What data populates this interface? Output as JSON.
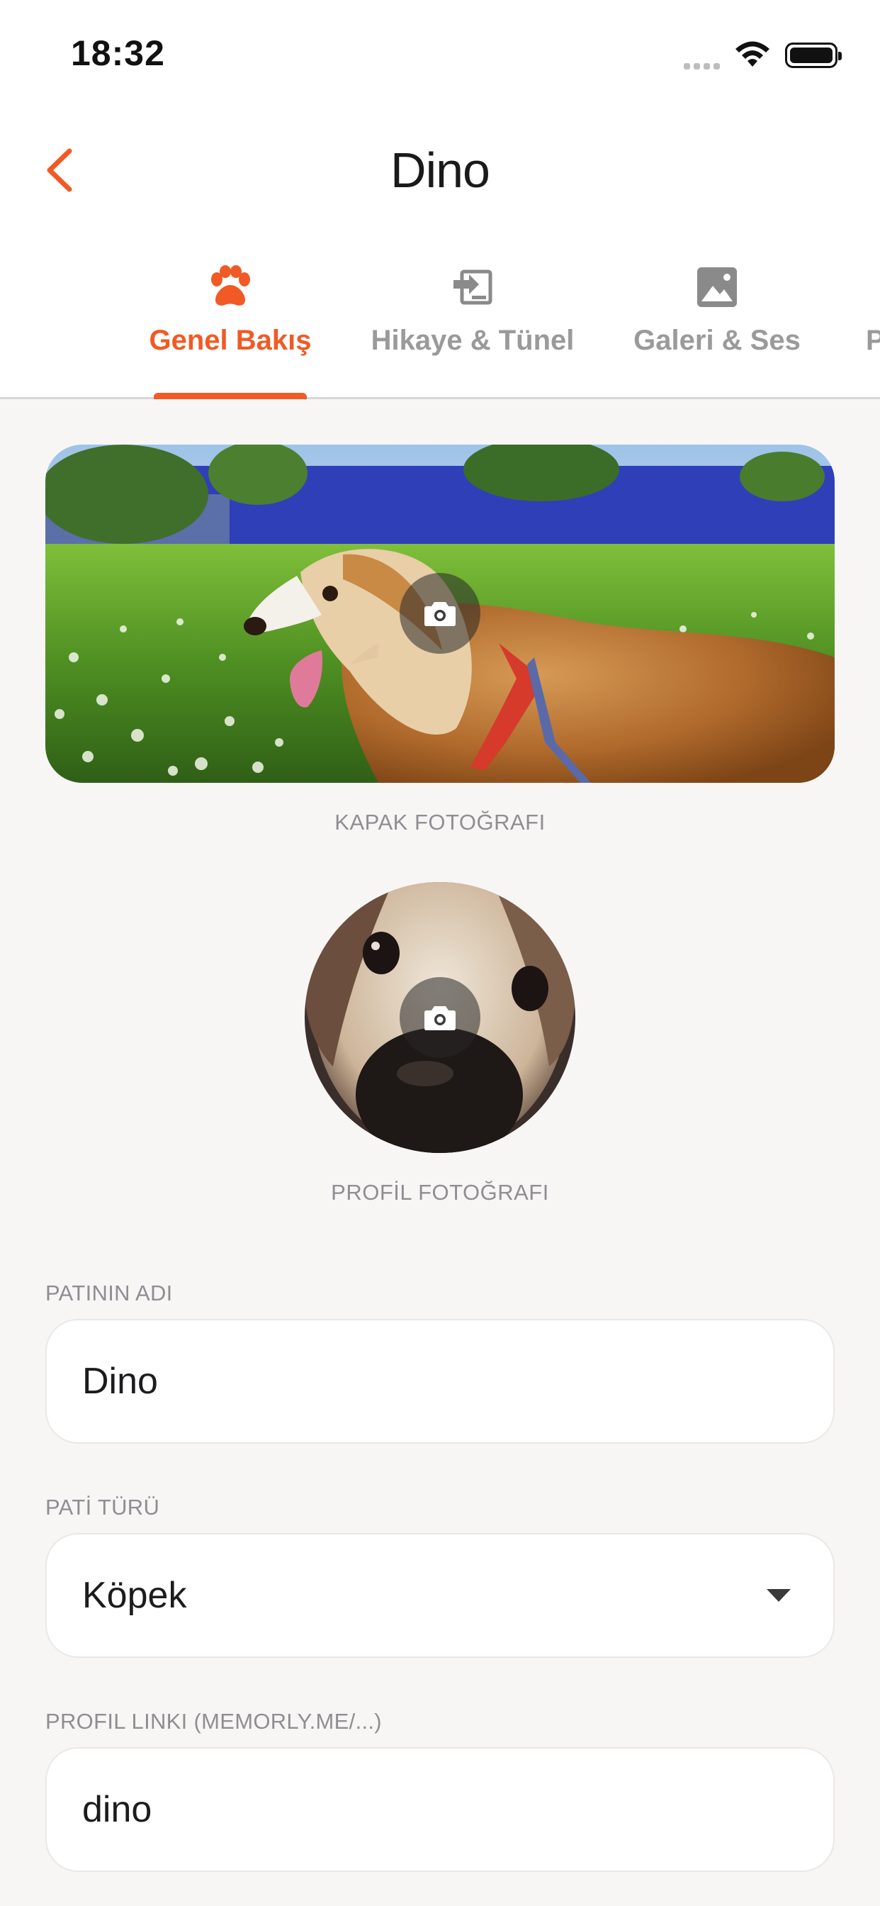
{
  "status_bar": {
    "time": "18:32"
  },
  "header": {
    "title": "Dino"
  },
  "tabs": [
    {
      "label": "Genel Bakış",
      "icon": "paw-icon",
      "active": true
    },
    {
      "label": "Hikaye & Tünel",
      "icon": "story-icon",
      "active": false
    },
    {
      "label": "Galeri & Ses",
      "icon": "gallery-icon",
      "active": false
    },
    {
      "label": "P",
      "icon": "",
      "active": false
    }
  ],
  "cover": {
    "caption": "KAPAK FOTOĞRAFI"
  },
  "profile_photo": {
    "caption": "PROFİL FOTOĞRAFI"
  },
  "form": {
    "name_label": "PATININ ADI",
    "name_value": "Dino",
    "type_label": "PATİ TÜRÜ",
    "type_value": "Köpek",
    "link_label": "PROFIL LINKI (MEMORLY.ME/...)",
    "link_value": "dino"
  },
  "colors": {
    "accent": "#f15a24",
    "inactive_tab": "#9a9a9a",
    "background": "#f8f6f5"
  }
}
